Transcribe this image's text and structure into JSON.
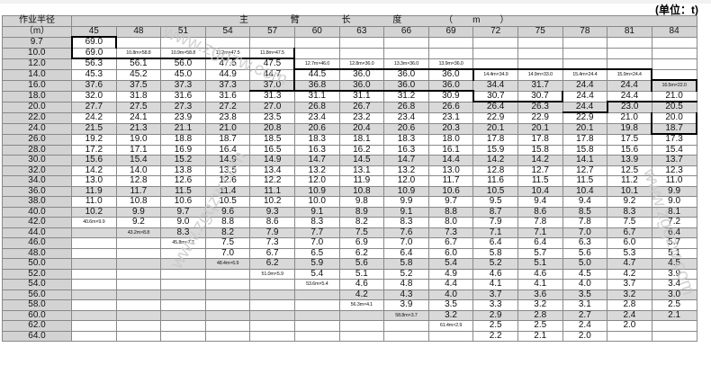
{
  "unit_label": "(单位：t)",
  "header": {
    "radius_label": "作业半径",
    "radius_unit": "（m）",
    "boom_length_label": "主 臂 长 度 （m）",
    "boom_lengths": [
      "45",
      "48",
      "51",
      "54",
      "57",
      "60",
      "63",
      "66",
      "69",
      "72",
      "75",
      "78",
      "81",
      "84"
    ]
  },
  "rows": [
    {
      "radius": "9.7",
      "cells": [
        "69.0",
        "",
        "",
        "",
        "",
        "",
        "",
        "",
        "",
        "",
        "",
        "",
        "",
        ""
      ]
    },
    {
      "radius": "10.0",
      "cells": [
        "69.0",
        "10.8m×58.8",
        "10.9m×58.8",
        "11.2m×47.5",
        "11.8m×47.5",
        "",
        "",
        "",
        "",
        "",
        "",
        "",
        "",
        ""
      ]
    },
    {
      "radius": "12.0",
      "cells": [
        "56.3",
        "56.1",
        "56.0",
        "47.5",
        "47.5",
        "12.7m×46.0",
        "12.8m×36.0",
        "13.3m×36.0",
        "13.9m×36.0",
        "",
        "",
        "",
        "",
        ""
      ]
    },
    {
      "radius": "14.0",
      "cells": [
        "45.3",
        "45.2",
        "45.0",
        "44.9",
        "44.7",
        "44.5",
        "36.0",
        "36.0",
        "36.0",
        "14.4m×34.9",
        "14.9m×33.0",
        "15.4m×24.4",
        "15.9m×24.4",
        ""
      ]
    },
    {
      "radius": "16.0",
      "cells": [
        "37.6",
        "37.5",
        "37.3",
        "37.3",
        "37.0",
        "36.8",
        "36.0",
        "36.0",
        "36.0",
        "34.4",
        "31.7",
        "24.4",
        "24.4",
        "16.5m×22.0"
      ]
    },
    {
      "radius": "18.0",
      "cells": [
        "32.0",
        "31.8",
        "31.6",
        "31.6",
        "31.3",
        "31.1",
        "31.1",
        "31.2",
        "30.9",
        "30.7",
        "30.7",
        "24.4",
        "24.4",
        "21.0"
      ]
    },
    {
      "radius": "20.0",
      "cells": [
        "27.7",
        "27.5",
        "27.3",
        "27.2",
        "27.0",
        "26.8",
        "26.7",
        "26.8",
        "26.6",
        "26.4",
        "26.3",
        "24.4",
        "23.0",
        "20.5"
      ]
    },
    {
      "radius": "22.0",
      "cells": [
        "24.2",
        "24.1",
        "23.9",
        "23.8",
        "23.5",
        "23.4",
        "23.2",
        "23.4",
        "23.1",
        "22.9",
        "22.9",
        "22.9",
        "21.0",
        "20.0"
      ]
    },
    {
      "radius": "24.0",
      "cells": [
        "21.5",
        "21.3",
        "21.1",
        "21.0",
        "20.8",
        "20.6",
        "20.4",
        "20.6",
        "20.3",
        "20.1",
        "20.1",
        "20.1",
        "19.8",
        "18.7"
      ]
    },
    {
      "radius": "26.0",
      "cells": [
        "19.2",
        "19.0",
        "18.8",
        "18.7",
        "18.5",
        "18.3",
        "18.1",
        "18.3",
        "18.0",
        "17.8",
        "17.8",
        "17.8",
        "17.5",
        "17.3"
      ]
    },
    {
      "radius": "28.0",
      "cells": [
        "17.2",
        "17.1",
        "16.9",
        "16.4",
        "16.5",
        "16.3",
        "16.2",
        "16.3",
        "16.1",
        "15.9",
        "15.8",
        "15.8",
        "15.6",
        "15.4"
      ]
    },
    {
      "radius": "30.0",
      "cells": [
        "15.6",
        "15.4",
        "15.2",
        "14.9",
        "14.9",
        "14.7",
        "14.5",
        "14.7",
        "14.4",
        "14.2",
        "14.2",
        "14.1",
        "13.9",
        "13.7"
      ]
    },
    {
      "radius": "32.0",
      "cells": [
        "14.2",
        "14.0",
        "13.8",
        "13.5",
        "13.4",
        "13.2",
        "13.1",
        "13.2",
        "13.0",
        "12.8",
        "12.7",
        "12.7",
        "12.5",
        "12.3"
      ]
    },
    {
      "radius": "34.0",
      "cells": [
        "13.0",
        "12.8",
        "12.6",
        "12.6",
        "12.2",
        "12.0",
        "11.9",
        "12.0",
        "11.7",
        "11.6",
        "11.5",
        "11.5",
        "11.2",
        "11.0"
      ]
    },
    {
      "radius": "36.0",
      "cells": [
        "11.9",
        "11.7",
        "11.5",
        "11.4",
        "11.1",
        "10.9",
        "10.8",
        "10.9",
        "10.6",
        "10.5",
        "10.4",
        "10.4",
        "10.1",
        "9.9"
      ]
    },
    {
      "radius": "38.0",
      "cells": [
        "11.0",
        "10.8",
        "10.6",
        "10.5",
        "10.2",
        "10.0",
        "9.8",
        "9.9",
        "9.7",
        "9.5",
        "9.4",
        "9.4",
        "9.2",
        "9.0"
      ]
    },
    {
      "radius": "40.0",
      "cells": [
        "10.2",
        "9.9",
        "9.7",
        "9.6",
        "9.3",
        "9.1",
        "8.9",
        "9.1",
        "8.8",
        "8.7",
        "8.6",
        "8.5",
        "8.3",
        "8.1"
      ]
    },
    {
      "radius": "42.0",
      "cells": [
        "40.6m×9.9",
        "9.2",
        "9.0",
        "8.8",
        "8.6",
        "8.3",
        "8.2",
        "8.3",
        "8.0",
        "7.9",
        "7.8",
        "7.8",
        "7.5",
        "7.2"
      ]
    },
    {
      "radius": "44.0",
      "cells": [
        "",
        "43.2m×8.8",
        "8.3",
        "8.2",
        "7.9",
        "7.7",
        "7.5",
        "7.6",
        "7.3",
        "7.1",
        "7.1",
        "7.0",
        "6.7",
        "6.4"
      ]
    },
    {
      "radius": "46.0",
      "cells": [
        "",
        "",
        "45.8m×7.7",
        "7.5",
        "7.3",
        "7.0",
        "6.9",
        "7.0",
        "6.7",
        "6.4",
        "6.4",
        "6.3",
        "6.0",
        "5.7"
      ]
    },
    {
      "radius": "48.0",
      "cells": [
        "",
        "",
        "",
        "7.0",
        "6.7",
        "6.5",
        "6.2",
        "6.4",
        "6.0",
        "5.8",
        "5.7",
        "5.6",
        "5.3",
        "5.1"
      ]
    },
    {
      "radius": "50.0",
      "cells": [
        "",
        "",
        "",
        "48.4m×6.9",
        "6.2",
        "5.9",
        "5.6",
        "5.8",
        "5.4",
        "5.2",
        "5.1",
        "5.0",
        "4.7",
        "4.5"
      ]
    },
    {
      "radius": "52.0",
      "cells": [
        "",
        "",
        "",
        "",
        "51.0m×5.9",
        "5.4",
        "5.1",
        "5.2",
        "4.9",
        "4.6",
        "4.6",
        "4.5",
        "4.2",
        "3.9"
      ]
    },
    {
      "radius": "54.0",
      "cells": [
        "",
        "",
        "",
        "",
        "",
        "53.6m×5.4",
        "4.6",
        "4.8",
        "4.4",
        "4.1",
        "4.1",
        "4.0",
        "3.7",
        "3.4"
      ]
    },
    {
      "radius": "56.0",
      "cells": [
        "",
        "",
        "",
        "",
        "",
        "",
        "4.2",
        "4.3",
        "4.0",
        "3.7",
        "3.6",
        "3.5",
        "3.2",
        "3.0"
      ]
    },
    {
      "radius": "58.0",
      "cells": [
        "",
        "",
        "",
        "",
        "",
        "",
        "56.3m×4.1",
        "3.9",
        "3.5",
        "3.3",
        "3.2",
        "3.1",
        "2.8",
        "2.5"
      ]
    },
    {
      "radius": "60.0",
      "cells": [
        "",
        "",
        "",
        "",
        "",
        "",
        "",
        "58.8m×3.7",
        "3.2",
        "2.9",
        "2.8",
        "2.7",
        "2.4",
        "2.1"
      ]
    },
    {
      "radius": "62.0",
      "cells": [
        "",
        "",
        "",
        "",
        "",
        "",
        "",
        "",
        "61.4m×2.9",
        "2.5",
        "2.5",
        "2.4",
        "2.0",
        ""
      ]
    },
    {
      "radius": "64.0",
      "cells": [
        "",
        "",
        "",
        "",
        "",
        "",
        "",
        "",
        "",
        "2.2",
        "2.1",
        "2.0",
        "",
        ""
      ]
    }
  ],
  "watermarks": [
    "www.zgqzw.com",
    "www.zgqzw.com",
    "www.zgqzw.com"
  ]
}
